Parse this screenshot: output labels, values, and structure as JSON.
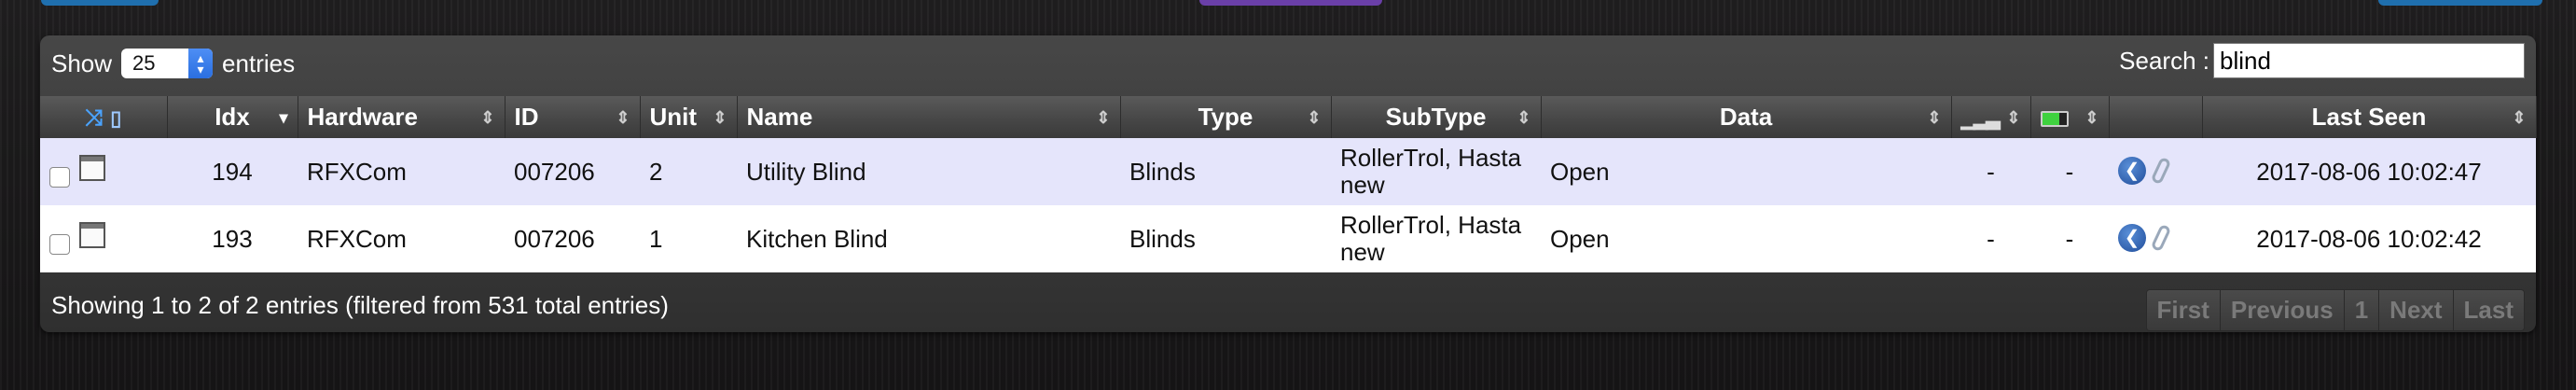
{
  "colors": {
    "top_button_blue": "#1f6fae",
    "top_button_purple": "#6a3fa8",
    "row_odd": "#e5e5fb",
    "row_even": "#ffffff"
  },
  "toolbar": {
    "show_label": "Show",
    "entries_value": "25",
    "entries_label": "entries",
    "search_label": "Search :",
    "search_value": "blind"
  },
  "table": {
    "columns": {
      "icons": "",
      "idx": "Idx",
      "hardware": "Hardware",
      "id": "ID",
      "unit": "Unit",
      "name": "Name",
      "type": "Type",
      "subtype": "SubType",
      "data": "Data",
      "signal": "",
      "battery": "",
      "actions": "",
      "last_seen": "Last Seen"
    },
    "rows": [
      {
        "idx": "194",
        "hardware": "RFXCom",
        "id": "007206",
        "unit": "2",
        "name": "Utility Blind",
        "type": "Blinds",
        "subtype": "RollerTrol, Hasta new",
        "data": "Open",
        "signal": "-",
        "battery": "-",
        "last_seen": "2017-08-06 10:02:47"
      },
      {
        "idx": "193",
        "hardware": "RFXCom",
        "id": "007206",
        "unit": "1",
        "name": "Kitchen Blind",
        "type": "Blinds",
        "subtype": "RollerTrol, Hasta new",
        "data": "Open",
        "signal": "-",
        "battery": "-",
        "last_seen": "2017-08-06 10:02:42"
      }
    ]
  },
  "footer": {
    "info": "Showing 1 to 2 of 2 entries (filtered from 531 total entries)",
    "pager": {
      "first": "First",
      "previous": "Previous",
      "page": "1",
      "next": "Next",
      "last": "Last"
    }
  }
}
